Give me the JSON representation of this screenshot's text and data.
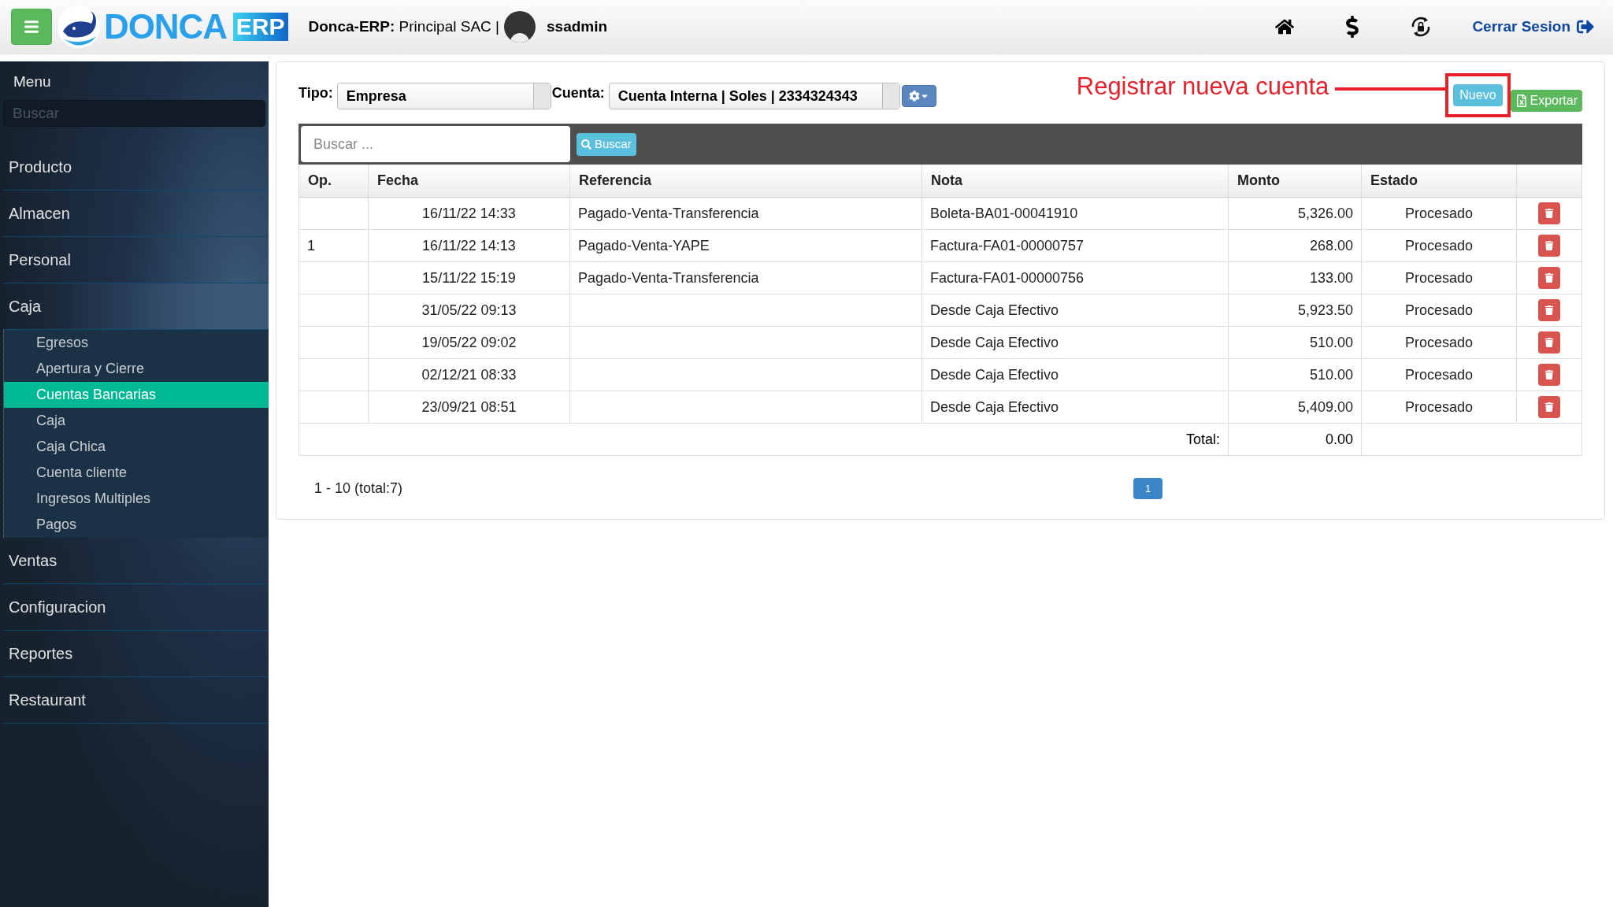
{
  "header": {
    "brand": "DONCA",
    "brand_badge": "ERP",
    "company_label": "Donca-ERP:",
    "company": "Principal SAC |",
    "user": "ssadmin",
    "logout": "Cerrar Sesion"
  },
  "sidebar": {
    "title": "Menu",
    "search": {
      "placeholder": "Buscar"
    },
    "items": [
      {
        "label": "Producto",
        "expanded": false
      },
      {
        "label": "Almacen",
        "expanded": false
      },
      {
        "label": "Personal",
        "expanded": false
      },
      {
        "label": "Caja",
        "expanded": true,
        "children": [
          {
            "label": "Egresos",
            "selected": false
          },
          {
            "label": "Apertura y Cierre",
            "selected": false
          },
          {
            "label": "Cuentas Bancarias",
            "selected": true
          },
          {
            "label": "Caja",
            "selected": false
          },
          {
            "label": "Caja Chica",
            "selected": false
          },
          {
            "label": "Cuenta cliente",
            "selected": false
          },
          {
            "label": "Ingresos Multiples",
            "selected": false
          },
          {
            "label": "Pagos",
            "selected": false
          }
        ]
      },
      {
        "label": "Ventas",
        "expanded": false
      },
      {
        "label": "Configuracion",
        "expanded": false
      },
      {
        "label": "Reportes",
        "expanded": false
      },
      {
        "label": "Restaurant",
        "expanded": false
      }
    ]
  },
  "filters": {
    "tipo_label": "Tipo:",
    "tipo": "Empresa",
    "cuenta_label": "Cuenta:",
    "cuenta": "Cuenta Interna | Soles | 2334324343"
  },
  "annotation": "Registrar nueva cuenta",
  "buttons": {
    "nuevo": "Nuevo",
    "exportar": "Exportar"
  },
  "search": {
    "placeholder": "Buscar ...",
    "button": "Buscar"
  },
  "table": {
    "columns": [
      "Op.",
      "Fecha",
      "Referencia",
      "Nota",
      "Monto",
      "Estado"
    ],
    "rows": [
      {
        "op": "",
        "fecha": "16/11/22 14:33",
        "referencia": "Pagado-Venta-Transferencia",
        "nota": "Boleta-BA01-00041910",
        "monto": "5,326.00",
        "estado": "Procesado"
      },
      {
        "op": "1",
        "fecha": "16/11/22 14:13",
        "referencia": "Pagado-Venta-YAPE",
        "nota": "Factura-FA01-00000757",
        "monto": "268.00",
        "estado": "Procesado"
      },
      {
        "op": "",
        "fecha": "15/11/22 15:19",
        "referencia": "Pagado-Venta-Transferencia",
        "nota": "Factura-FA01-00000756",
        "monto": "133.00",
        "estado": "Procesado"
      },
      {
        "op": "",
        "fecha": "31/05/22 09:13",
        "referencia": "",
        "nota": "Desde Caja Efectivo",
        "monto": "5,923.50",
        "estado": "Procesado"
      },
      {
        "op": "",
        "fecha": "19/05/22 09:02",
        "referencia": "",
        "nota": "Desde Caja Efectivo",
        "monto": "510.00",
        "estado": "Procesado"
      },
      {
        "op": "",
        "fecha": "02/12/21 08:33",
        "referencia": "",
        "nota": "Desde Caja Efectivo",
        "monto": "510.00",
        "estado": "Procesado"
      },
      {
        "op": "",
        "fecha": "23/09/21 08:51",
        "referencia": "",
        "nota": "Desde Caja Efectivo",
        "monto": "5,409.00",
        "estado": "Procesado"
      }
    ],
    "total_label": "Total:",
    "total": "0.00"
  },
  "pagination": {
    "summary": "1 - 10 (total:7)",
    "pages": [
      {
        "label": "1",
        "selected": true
      }
    ]
  }
}
